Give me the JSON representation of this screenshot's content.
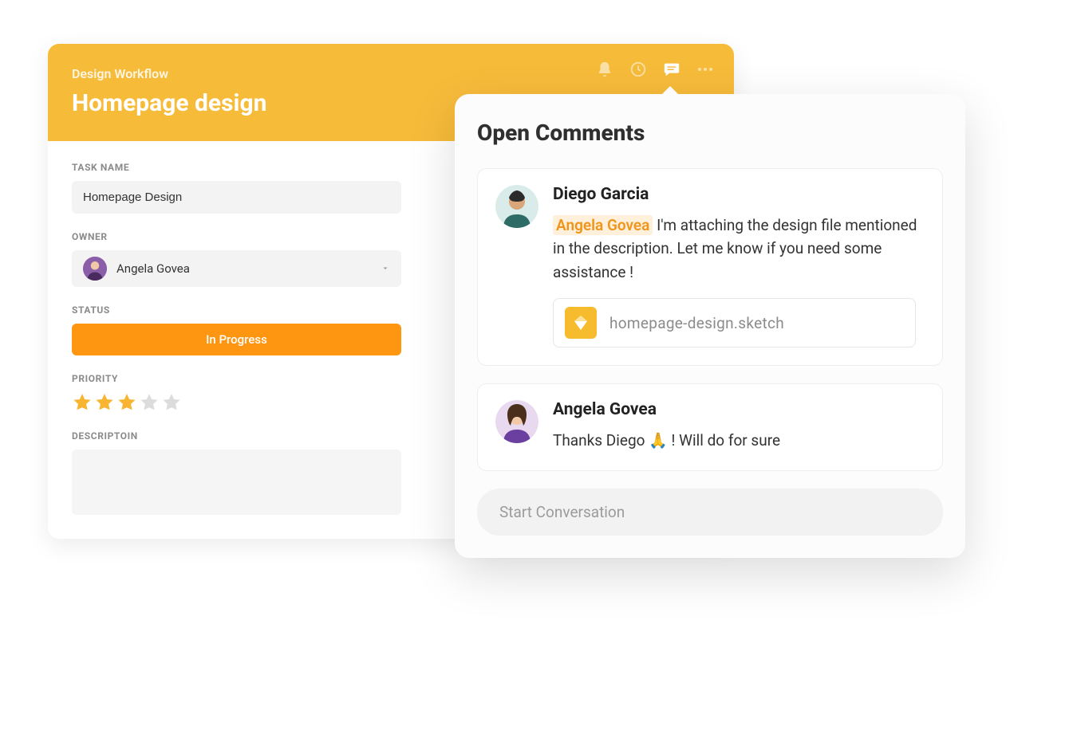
{
  "header": {
    "breadcrumb": "Design Workflow",
    "title": "Homepage design",
    "icons": {
      "bell": "bell-icon",
      "clock": "clock-icon",
      "chat": "chat-icon",
      "more": "more-icon"
    }
  },
  "fields": {
    "task_name_label": "TASK NAME",
    "task_name_value": "Homepage Design",
    "owner_label": "OWNER",
    "owner_value": "Angela Govea",
    "status_label": "STATUS",
    "status_value": "In Progress",
    "priority_label": "PRIORITY",
    "priority_value": 3,
    "priority_max": 5,
    "description_label": "DESCRIPTOIN",
    "description_value": ""
  },
  "comments": {
    "title": "Open Comments",
    "items": [
      {
        "author": "Diego Garcia",
        "mention": "Angela Govea",
        "text": "I'm attaching the design file mentioned in the description. Let me know if you need some assistance !",
        "attachment": "homepage-design.sketch"
      },
      {
        "author": "Angela Govea",
        "mention": "",
        "text": "Thanks Diego 🙏 ! Will do for sure",
        "attachment": ""
      }
    ],
    "input_placeholder": "Start Conversation"
  },
  "colors": {
    "accent": "#f7bb3a",
    "status": "#ff9612",
    "mention_bg": "#fff0db",
    "mention_fg": "#f0941a"
  }
}
